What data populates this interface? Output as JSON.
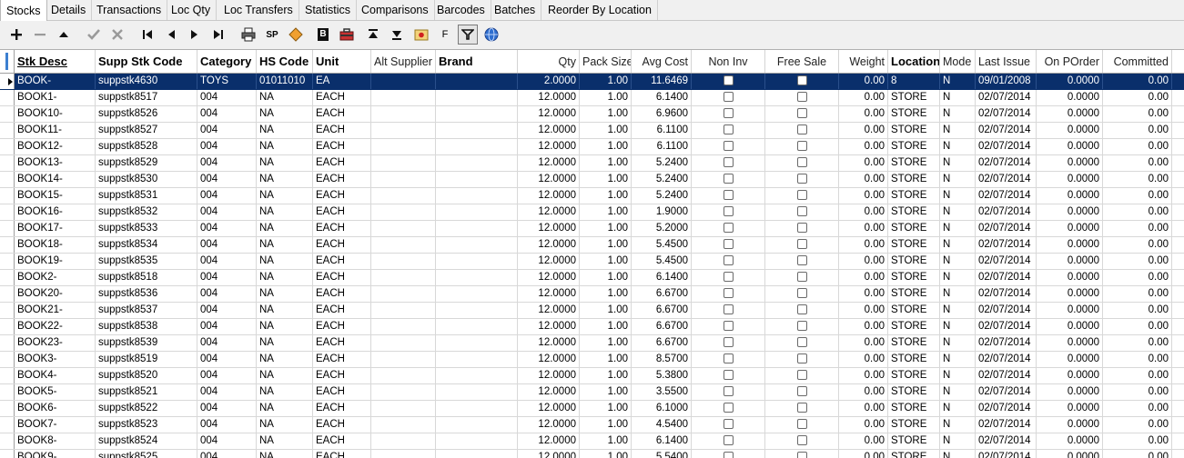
{
  "tabs": [
    {
      "label": "Stocks",
      "active": true
    },
    {
      "label": "Details"
    },
    {
      "label": "Transactions"
    },
    {
      "label": "Loc Qty"
    },
    {
      "label": "Loc Transfers"
    },
    {
      "label": "Statistics"
    },
    {
      "label": "Comparisons"
    },
    {
      "label": "Barcodes"
    },
    {
      "label": "Batches"
    },
    {
      "label": "Reorder By Location"
    }
  ],
  "toolbar": {
    "sp_label": "SP",
    "b_label": "B",
    "f_label": "F",
    "filter_pressed": true
  },
  "columns": [
    "Stk Desc",
    "Supp Stk Code",
    "Category",
    "HS Code",
    "Unit",
    "Alt Supplier",
    "Brand",
    "Qty",
    "Pack Size",
    "Avg Cost",
    "Non Inv",
    "Free Sale",
    "Weight",
    "Location",
    "Mode",
    "Last Issue",
    "On POrder",
    "Committed"
  ],
  "rows": [
    {
      "desc": "BOOK-",
      "supp": "suppstk4630",
      "cat": "TOYS",
      "hs": "01011010",
      "unit": "EA",
      "alt": "",
      "brand": "",
      "qty": "2.0000",
      "pack": "1.00",
      "cost": "11.6469",
      "weight": "0.00",
      "loc": "8",
      "mode": "N",
      "last": "09/01/2008",
      "onpo": "0.0000",
      "comm": "0.00",
      "selected": true
    },
    {
      "desc": "BOOK1-",
      "supp": "suppstk8517",
      "cat": "004",
      "hs": "NA",
      "unit": "EACH",
      "alt": "",
      "brand": "",
      "qty": "12.0000",
      "pack": "1.00",
      "cost": "6.1400",
      "weight": "0.00",
      "loc": "STORE",
      "mode": "N",
      "last": "02/07/2014",
      "onpo": "0.0000",
      "comm": "0.00"
    },
    {
      "desc": "BOOK10-",
      "supp": "suppstk8526",
      "cat": "004",
      "hs": "NA",
      "unit": "EACH",
      "alt": "",
      "brand": "",
      "qty": "12.0000",
      "pack": "1.00",
      "cost": "6.9600",
      "weight": "0.00",
      "loc": "STORE",
      "mode": "N",
      "last": "02/07/2014",
      "onpo": "0.0000",
      "comm": "0.00"
    },
    {
      "desc": "BOOK11-",
      "supp": "suppstk8527",
      "cat": "004",
      "hs": "NA",
      "unit": "EACH",
      "alt": "",
      "brand": "",
      "qty": "12.0000",
      "pack": "1.00",
      "cost": "6.1100",
      "weight": "0.00",
      "loc": "STORE",
      "mode": "N",
      "last": "02/07/2014",
      "onpo": "0.0000",
      "comm": "0.00"
    },
    {
      "desc": "BOOK12-",
      "supp": "suppstk8528",
      "cat": "004",
      "hs": "NA",
      "unit": "EACH",
      "alt": "",
      "brand": "",
      "qty": "12.0000",
      "pack": "1.00",
      "cost": "6.1100",
      "weight": "0.00",
      "loc": "STORE",
      "mode": "N",
      "last": "02/07/2014",
      "onpo": "0.0000",
      "comm": "0.00"
    },
    {
      "desc": "BOOK13-",
      "supp": "suppstk8529",
      "cat": "004",
      "hs": "NA",
      "unit": "EACH",
      "alt": "",
      "brand": "",
      "qty": "12.0000",
      "pack": "1.00",
      "cost": "5.2400",
      "weight": "0.00",
      "loc": "STORE",
      "mode": "N",
      "last": "02/07/2014",
      "onpo": "0.0000",
      "comm": "0.00"
    },
    {
      "desc": "BOOK14-",
      "supp": "suppstk8530",
      "cat": "004",
      "hs": "NA",
      "unit": "EACH",
      "alt": "",
      "brand": "",
      "qty": "12.0000",
      "pack": "1.00",
      "cost": "5.2400",
      "weight": "0.00",
      "loc": "STORE",
      "mode": "N",
      "last": "02/07/2014",
      "onpo": "0.0000",
      "comm": "0.00"
    },
    {
      "desc": "BOOK15-",
      "supp": "suppstk8531",
      "cat": "004",
      "hs": "NA",
      "unit": "EACH",
      "alt": "",
      "brand": "",
      "qty": "12.0000",
      "pack": "1.00",
      "cost": "5.2400",
      "weight": "0.00",
      "loc": "STORE",
      "mode": "N",
      "last": "02/07/2014",
      "onpo": "0.0000",
      "comm": "0.00"
    },
    {
      "desc": "BOOK16-",
      "supp": "suppstk8532",
      "cat": "004",
      "hs": "NA",
      "unit": "EACH",
      "alt": "",
      "brand": "",
      "qty": "12.0000",
      "pack": "1.00",
      "cost": "1.9000",
      "weight": "0.00",
      "loc": "STORE",
      "mode": "N",
      "last": "02/07/2014",
      "onpo": "0.0000",
      "comm": "0.00"
    },
    {
      "desc": "BOOK17-",
      "supp": "suppstk8533",
      "cat": "004",
      "hs": "NA",
      "unit": "EACH",
      "alt": "",
      "brand": "",
      "qty": "12.0000",
      "pack": "1.00",
      "cost": "5.2000",
      "weight": "0.00",
      "loc": "STORE",
      "mode": "N",
      "last": "02/07/2014",
      "onpo": "0.0000",
      "comm": "0.00"
    },
    {
      "desc": "BOOK18-",
      "supp": "suppstk8534",
      "cat": "004",
      "hs": "NA",
      "unit": "EACH",
      "alt": "",
      "brand": "",
      "qty": "12.0000",
      "pack": "1.00",
      "cost": "5.4500",
      "weight": "0.00",
      "loc": "STORE",
      "mode": "N",
      "last": "02/07/2014",
      "onpo": "0.0000",
      "comm": "0.00"
    },
    {
      "desc": "BOOK19-",
      "supp": "suppstk8535",
      "cat": "004",
      "hs": "NA",
      "unit": "EACH",
      "alt": "",
      "brand": "",
      "qty": "12.0000",
      "pack": "1.00",
      "cost": "5.4500",
      "weight": "0.00",
      "loc": "STORE",
      "mode": "N",
      "last": "02/07/2014",
      "onpo": "0.0000",
      "comm": "0.00"
    },
    {
      "desc": "BOOK2-",
      "supp": "suppstk8518",
      "cat": "004",
      "hs": "NA",
      "unit": "EACH",
      "alt": "",
      "brand": "",
      "qty": "12.0000",
      "pack": "1.00",
      "cost": "6.1400",
      "weight": "0.00",
      "loc": "STORE",
      "mode": "N",
      "last": "02/07/2014",
      "onpo": "0.0000",
      "comm": "0.00"
    },
    {
      "desc": "BOOK20-",
      "supp": "suppstk8536",
      "cat": "004",
      "hs": "NA",
      "unit": "EACH",
      "alt": "",
      "brand": "",
      "qty": "12.0000",
      "pack": "1.00",
      "cost": "6.6700",
      "weight": "0.00",
      "loc": "STORE",
      "mode": "N",
      "last": "02/07/2014",
      "onpo": "0.0000",
      "comm": "0.00"
    },
    {
      "desc": "BOOK21-",
      "supp": "suppstk8537",
      "cat": "004",
      "hs": "NA",
      "unit": "EACH",
      "alt": "",
      "brand": "",
      "qty": "12.0000",
      "pack": "1.00",
      "cost": "6.6700",
      "weight": "0.00",
      "loc": "STORE",
      "mode": "N",
      "last": "02/07/2014",
      "onpo": "0.0000",
      "comm": "0.00"
    },
    {
      "desc": "BOOK22-",
      "supp": "suppstk8538",
      "cat": "004",
      "hs": "NA",
      "unit": "EACH",
      "alt": "",
      "brand": "",
      "qty": "12.0000",
      "pack": "1.00",
      "cost": "6.6700",
      "weight": "0.00",
      "loc": "STORE",
      "mode": "N",
      "last": "02/07/2014",
      "onpo": "0.0000",
      "comm": "0.00"
    },
    {
      "desc": "BOOK23-",
      "supp": "suppstk8539",
      "cat": "004",
      "hs": "NA",
      "unit": "EACH",
      "alt": "",
      "brand": "",
      "qty": "12.0000",
      "pack": "1.00",
      "cost": "6.6700",
      "weight": "0.00",
      "loc": "STORE",
      "mode": "N",
      "last": "02/07/2014",
      "onpo": "0.0000",
      "comm": "0.00"
    },
    {
      "desc": "BOOK3-",
      "supp": "suppstk8519",
      "cat": "004",
      "hs": "NA",
      "unit": "EACH",
      "alt": "",
      "brand": "",
      "qty": "12.0000",
      "pack": "1.00",
      "cost": "8.5700",
      "weight": "0.00",
      "loc": "STORE",
      "mode": "N",
      "last": "02/07/2014",
      "onpo": "0.0000",
      "comm": "0.00"
    },
    {
      "desc": "BOOK4-",
      "supp": "suppstk8520",
      "cat": "004",
      "hs": "NA",
      "unit": "EACH",
      "alt": "",
      "brand": "",
      "qty": "12.0000",
      "pack": "1.00",
      "cost": "5.3800",
      "weight": "0.00",
      "loc": "STORE",
      "mode": "N",
      "last": "02/07/2014",
      "onpo": "0.0000",
      "comm": "0.00"
    },
    {
      "desc": "BOOK5-",
      "supp": "suppstk8521",
      "cat": "004",
      "hs": "NA",
      "unit": "EACH",
      "alt": "",
      "brand": "",
      "qty": "12.0000",
      "pack": "1.00",
      "cost": "3.5500",
      "weight": "0.00",
      "loc": "STORE",
      "mode": "N",
      "last": "02/07/2014",
      "onpo": "0.0000",
      "comm": "0.00"
    },
    {
      "desc": "BOOK6-",
      "supp": "suppstk8522",
      "cat": "004",
      "hs": "NA",
      "unit": "EACH",
      "alt": "",
      "brand": "",
      "qty": "12.0000",
      "pack": "1.00",
      "cost": "6.1000",
      "weight": "0.00",
      "loc": "STORE",
      "mode": "N",
      "last": "02/07/2014",
      "onpo": "0.0000",
      "comm": "0.00"
    },
    {
      "desc": "BOOK7-",
      "supp": "suppstk8523",
      "cat": "004",
      "hs": "NA",
      "unit": "EACH",
      "alt": "",
      "brand": "",
      "qty": "12.0000",
      "pack": "1.00",
      "cost": "4.5400",
      "weight": "0.00",
      "loc": "STORE",
      "mode": "N",
      "last": "02/07/2014",
      "onpo": "0.0000",
      "comm": "0.00"
    },
    {
      "desc": "BOOK8-",
      "supp": "suppstk8524",
      "cat": "004",
      "hs": "NA",
      "unit": "EACH",
      "alt": "",
      "brand": "",
      "qty": "12.0000",
      "pack": "1.00",
      "cost": "6.1400",
      "weight": "0.00",
      "loc": "STORE",
      "mode": "N",
      "last": "02/07/2014",
      "onpo": "0.0000",
      "comm": "0.00"
    },
    {
      "desc": "BOOK9-",
      "supp": "suppstk8525",
      "cat": "004",
      "hs": "NA",
      "unit": "EACH",
      "alt": "",
      "brand": "",
      "qty": "12.0000",
      "pack": "1.00",
      "cost": "5.5400",
      "weight": "0.00",
      "loc": "STORE",
      "mode": "N",
      "last": "02/07/2014",
      "onpo": "0.0000",
      "comm": "0.00"
    }
  ],
  "colors": {
    "selected_row_bg": "#0a2f6b",
    "grid_line": "#d8d8d8",
    "toolbar_bg": "#f0f0f0"
  }
}
